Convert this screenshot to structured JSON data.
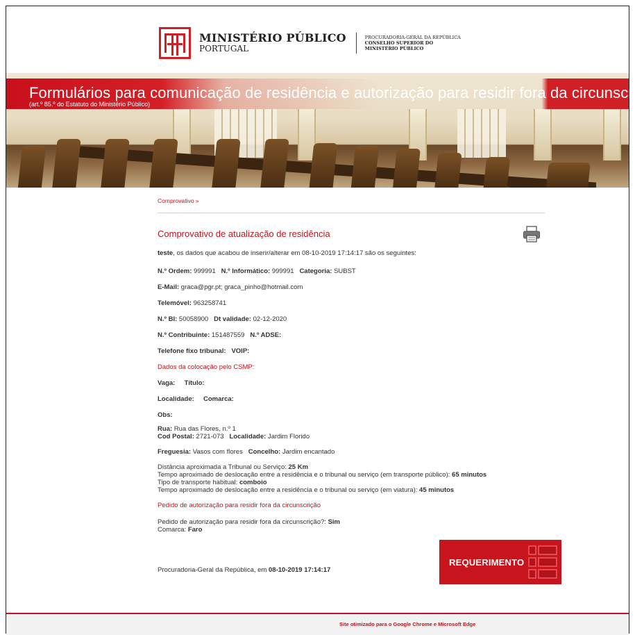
{
  "header": {
    "org_name": "MINISTÉRIO PÚBLICO",
    "org_country": "PORTUGAL",
    "org_sub_1": "PROCURADORIA-GERAL DA REPÚBLICA",
    "org_sub_2": "CONSELHO SUPERIOR DO",
    "org_sub_3": "MINISTÉRIO PÚBLICO"
  },
  "banner": {
    "title": "Formulários para comunicação de residência e autorização para residir fora da circunscrição",
    "subtitle": "(art.º 85.º do Estatuto do Ministério Público)"
  },
  "breadcrumb": {
    "label": "Comprovativo »"
  },
  "page": {
    "title": "Comprovativo de atualização de residência",
    "print_icon": "printer-icon"
  },
  "intro": {
    "name": "teste",
    "text": ", os dados que acabou de inserir/alterar em 08-10-2019 17:14:17 são os seguintes:"
  },
  "fields": {
    "ordem_label": "N.º Ordem:",
    "ordem_value": "999991",
    "informatico_label": "N.º Informático:",
    "informatico_value": "999991",
    "categoria_label": "Categoria:",
    "categoria_value": "SUBST",
    "email_label": "E-Mail:",
    "email_value": "graca@pgr.pt; graca_pinho@hotmail.com",
    "telemovel_label": "Telemóvel:",
    "telemovel_value": "963258741",
    "bi_label": "N.º BI:",
    "bi_value": "50058900",
    "validade_label": "Dt validade:",
    "validade_value": "02-12-2020",
    "contribuinte_label": "N.º Contribuinte:",
    "contribuinte_value": "151487559",
    "adse_label": "N.º ADSE:",
    "telefone_label": "Telefone fixo tribunal:",
    "voip_label": "VOIP:"
  },
  "csmp": {
    "section_title": "Dados da colocação pelo CSMP:",
    "vaga_label": "Vaga:",
    "titulo_label": "Título:",
    "localidade_label": "Localidade:",
    "comarca_label": "Comarca:",
    "obs_label": "Obs:"
  },
  "address": {
    "rua_label": "Rua:",
    "rua_value": "Rua das Flores, n.º 1",
    "cod_label": "Cod Postal:",
    "cod_value": "2721-073",
    "localidade_label": "Localidade:",
    "localidade_value": "Jardim Florido",
    "freguesia_label": "Freguesia:",
    "freguesia_value": "Vasos com flores",
    "concelho_label": "Concelho:",
    "concelho_value": "Jardim encantado"
  },
  "travel": {
    "distancia_text": "Distância aproximada a Tribunal ou Serviço:",
    "distancia_value": "25  Km",
    "tempo_publico_text": "Tempo aproximado de deslocação entre a residência e o tribunal ou serviço (em transporte público):",
    "tempo_publico_value": "65  minutos",
    "transporte_text": "Tipo de transporte habitual:",
    "transporte_value": "comboio",
    "tempo_viatura_text": "Tempo aproximado de deslocação entre a residência e o tribunal ou serviço (em viatura):",
    "tempo_viatura_value": "45  minutos"
  },
  "autorizacao": {
    "section_title": "Pedido de autorização para residir fora da circunscrição",
    "pedido_text": "Pedido de autorização para residir fora da circunscrição?:",
    "pedido_value": "Sim",
    "comarca_text": "Comarca:",
    "comarca_value": "Faro"
  },
  "signature": {
    "text": "Procuradoria-Geral da República, em",
    "date": "08-10-2019 17:14:17"
  },
  "requerimento_button": {
    "label": "REQUERIMENTO"
  },
  "footer": {
    "text": "Site otimizado para o Google Chrome e Microsoft Edge"
  },
  "colors": {
    "accent": "#c0151c",
    "brand_red": "#d11f26"
  }
}
